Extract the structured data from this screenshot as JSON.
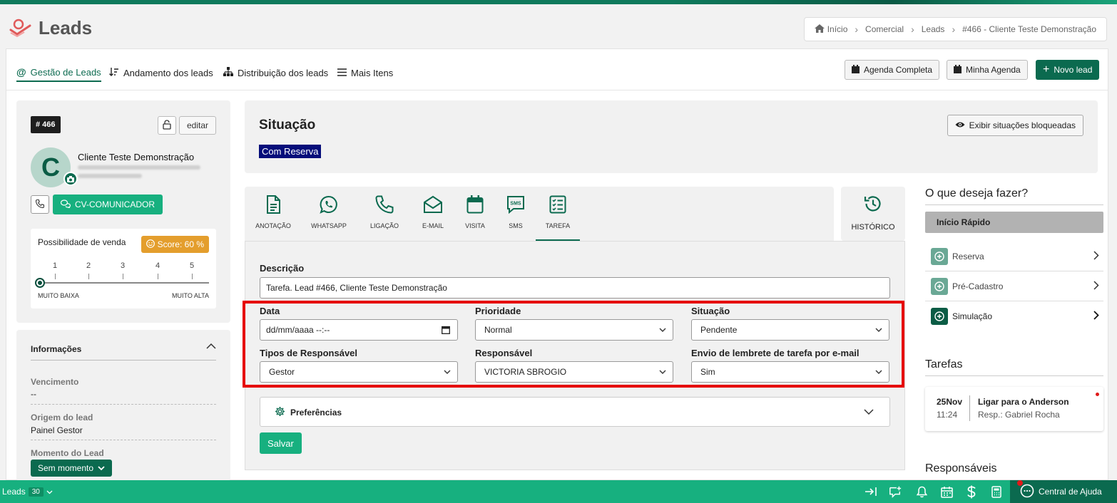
{
  "app": {
    "title": "Leads"
  },
  "breadcrumb": {
    "items": [
      "Início",
      "Comercial",
      "Leads",
      "#466 - Cliente Teste Demonstração"
    ]
  },
  "nav": {
    "tabs": [
      {
        "label": "Gestão de Leads",
        "icon": "at-icon",
        "active": true
      },
      {
        "label": "Andamento dos leads",
        "icon": "sort-down-icon"
      },
      {
        "label": "Distribuição dos leads",
        "icon": "sitemap-icon"
      },
      {
        "label": "Mais Itens",
        "icon": "bars-icon"
      }
    ],
    "agenda_completa": "Agenda Completa",
    "minha_agenda": "Minha Agenda",
    "novo_lead": "Novo lead"
  },
  "lead": {
    "id": "# 466",
    "edit_label": "editar",
    "avatar_letter": "C",
    "name": "Cliente Teste Demonstração",
    "cv_button": "CV-COMUNICADOR",
    "probability_title": "Possibilidade de venda",
    "score": "Score: 60 %",
    "ticks": [
      "1",
      "2",
      "3",
      "4",
      "5"
    ],
    "slider_min_label": "MUITO BAIXA",
    "slider_max_label": "MUITO ALTA",
    "slider_level": 0
  },
  "info": {
    "title": "Informações",
    "vencimento_label": "Vencimento",
    "vencimento_value": "--",
    "origem_label": "Origem do lead",
    "origem_value": "Painel Gestor",
    "momento_label": "Momento do Lead",
    "momento_value": "Sem momento"
  },
  "situacao": {
    "title": "Situação",
    "badge": "Com Reserva",
    "blocked_button": "Exibir situações bloqueadas"
  },
  "activity_tabs": [
    {
      "label": "ANOTAÇÃO",
      "icon": "file-icon"
    },
    {
      "label": "WHATSAPP",
      "icon": "whatsapp-icon"
    },
    {
      "label": "LIGAÇÃO",
      "icon": "phone-icon"
    },
    {
      "label": "E-MAIL",
      "icon": "envelope-icon"
    },
    {
      "label": "VISITA",
      "icon": "calendar-icon"
    },
    {
      "label": "SMS",
      "icon": "sms-icon"
    },
    {
      "label": "TAREFA",
      "icon": "tasks-icon",
      "active": true
    }
  ],
  "historico": {
    "label": "HISTÓRICO"
  },
  "form": {
    "descricao_label": "Descrição",
    "descricao_value": "Tarefa. Lead #466, Cliente Teste Demonstração",
    "data_label": "Data",
    "data_placeholder": "dd/mm/aaaa --:--",
    "prioridade_label": "Prioridade",
    "prioridade_value": "Normal",
    "situacao_label": "Situação",
    "situacao_value": "Pendente",
    "tipos_label": "Tipos de Responsável",
    "tipos_value": "Gestor",
    "responsavel_label": "Responsável",
    "responsavel_value": "VICTORIA SBROGIO",
    "envio_label": "Envio de lembrete de tarefa por e-mail",
    "envio_value": "Sim",
    "preferencias_label": "Preferências",
    "save_label": "Salvar"
  },
  "right": {
    "question": "O que deseja fazer?",
    "quick_start": "Início Rápido",
    "items": [
      "Reserva",
      "Pré-Cadastro",
      "Simulação"
    ],
    "tarefas_title": "Tarefas",
    "task": {
      "day": "25Nov",
      "time": "11:24",
      "title": "Ligar para o Anderson",
      "resp": "Resp.: Gabriel Rocha"
    },
    "responsaveis_title": "Responsáveis"
  },
  "bottom": {
    "leads_label": "Leads",
    "leads_count": "30",
    "help_label": "Central de Ajuda"
  },
  "colors": {
    "primary_dark": "#0b6a4f",
    "primary": "#17b07f",
    "score": "#e49e2d",
    "situation_badge": "#050d7a",
    "highlight": "#e60000"
  }
}
